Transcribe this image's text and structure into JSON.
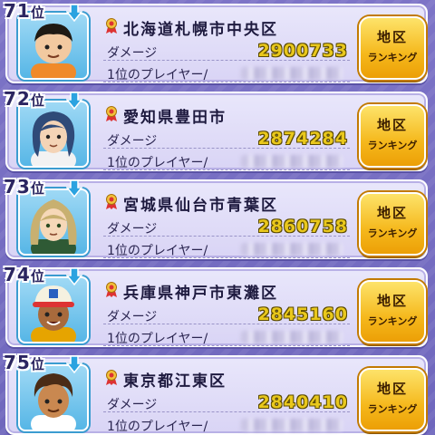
{
  "labels": {
    "rank_suffix": "位",
    "damage_label": "ダメージ",
    "top_player_label": "1位のプレイヤー/",
    "button_line1": "地区",
    "button_line2": "ランキング"
  },
  "rows": [
    {
      "rank": "71",
      "region": "北海道札幌市中央区",
      "damage": "2900733",
      "avatar": {
        "hair": "#1f1a14",
        "skin": "#f2c9a0",
        "shirt": "#f08a2a"
      }
    },
    {
      "rank": "72",
      "region": "愛知県豊田市",
      "damage": "2874284",
      "avatar": {
        "hair": "#2f4a78",
        "skin": "#f4d4b6",
        "shirt": "#f2f2f2"
      }
    },
    {
      "rank": "73",
      "region": "宮城県仙台市青葉区",
      "damage": "2860758",
      "avatar": {
        "hair": "#c8b070",
        "skin": "#f6d8b8",
        "shirt": "#2f5a35"
      }
    },
    {
      "rank": "74",
      "region": "兵庫県神戸市東灘区",
      "damage": "2845160",
      "avatar": {
        "hair": "#f5f1e0",
        "skin": "#a86a3c",
        "shirt": "#e6a400"
      }
    },
    {
      "rank": "75",
      "region": "東京都江東区",
      "damage": "2840410",
      "avatar": {
        "hair": "#4a2c16",
        "skin": "#c98850",
        "shirt": "#ffffff"
      }
    }
  ],
  "icons": {
    "rank_change": "down-arrow-icon",
    "medal": "medal-icon"
  },
  "colors": {
    "background": "#7d74c7",
    "damage_value": "#e9c81c",
    "button": "#f5b81c",
    "down_arrow": "#2ba3e0"
  }
}
